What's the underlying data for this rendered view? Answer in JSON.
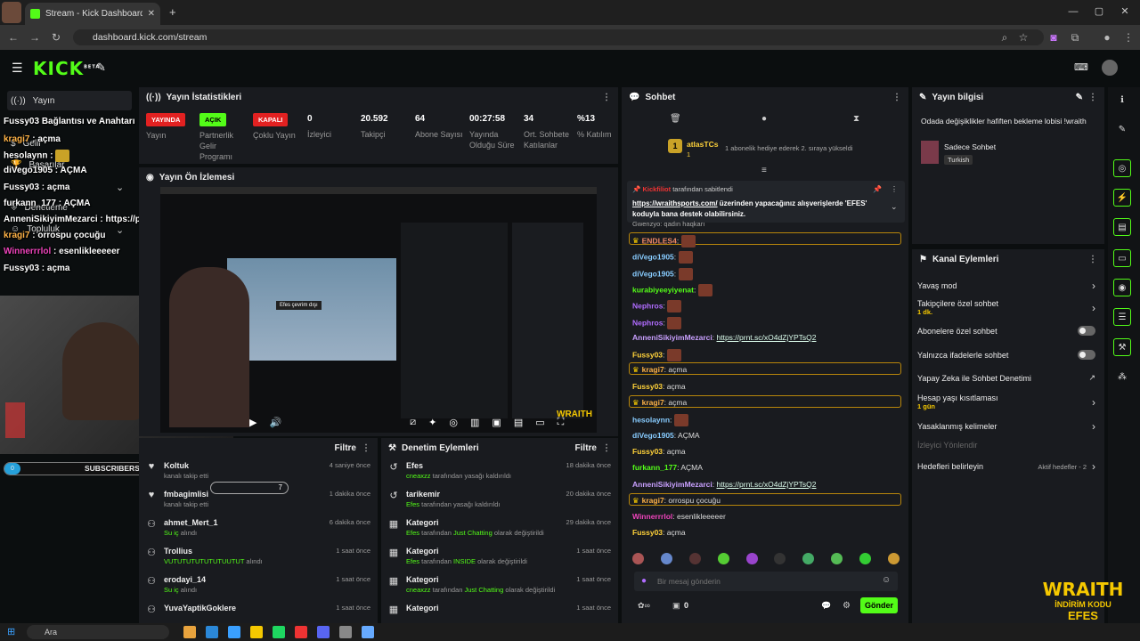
{
  "browser": {
    "tab_title": "Stream - Kick Dashboard",
    "url": "dashboard.kick.com/stream"
  },
  "header": {
    "logo": "KICK",
    "logo_sup": "BETA"
  },
  "sidebar": {
    "items": [
      {
        "label": "Yayın"
      },
      {
        "label": "Gelir"
      },
      {
        "label": "Başarılar"
      },
      {
        "label": "Denetleme"
      },
      {
        "label": "Topluluk"
      }
    ]
  },
  "overlay_chat": [
    {
      "user": "Fussy03",
      "text": "Bağlantısı ve Anahtarı"
    },
    {
      "user": "kragi7",
      "text": "açma"
    },
    {
      "user": "hesolaynn",
      "text": ""
    },
    {
      "user": "diVego1905",
      "text": "AÇMA"
    },
    {
      "user": "Fussy03",
      "text": "açma"
    },
    {
      "user": "furkann_177",
      "text": "AÇMA"
    },
    {
      "user": "AnneniSikiyimMezarci",
      "text": "https://prnt.sc/xO4dZjYPTsQ2"
    },
    {
      "user": "kragi7",
      "text": "orrospu çocuğu"
    },
    {
      "user": "Winnerrrlol",
      "text": "esenlikleeeeer"
    },
    {
      "user": "Fussy03",
      "text": "açma"
    }
  ],
  "subscribers": {
    "count": "0",
    "label": "SUBSCRIBERS"
  },
  "stats": {
    "title": "Yayın İstatistikleri",
    "items": [
      {
        "badge": "YAYINDA",
        "label": "Yayın",
        "color": "#e22121"
      },
      {
        "badge": "AÇIK",
        "label": "Partnerlik Gelir Programı",
        "color": "#53fc18"
      },
      {
        "badge": "KAPALI",
        "label": "Çoklu Yayın",
        "color": "#e22121"
      },
      {
        "value": "0",
        "label": "İzleyici"
      },
      {
        "value": "20.592",
        "label": "Takipçi"
      },
      {
        "value": "64",
        "label": "Abone Sayısı"
      },
      {
        "value": "00:27:58",
        "label": "Yayında Olduğu Süre"
      },
      {
        "value": "34",
        "label": "Ort. Sohbete Katılanlar"
      },
      {
        "value": "%13",
        "label": "% Katılım"
      }
    ]
  },
  "preview": {
    "title": "Yayın Ön İzlemesi",
    "inner_text": "Efes çevrim dışı",
    "brand": "WRAITH"
  },
  "activity": {
    "filter": "Filtre",
    "rows": [
      {
        "icon": "heart-icon",
        "name": "Koltuk",
        "sub": "kanalı takip etti",
        "time": "4 saniye önce",
        "count": "7"
      },
      {
        "icon": "heart-icon",
        "name": "fmbagimlisi",
        "sub": "kanalı takip etti",
        "time": "1 dakika önce"
      },
      {
        "icon": "gift-icon",
        "name": "ahmet_Mert_1",
        "sub": "Su iç",
        "sub2": "alındı",
        "time": "6 dakika önce"
      },
      {
        "icon": "gift-icon",
        "name": "Trollius",
        "sub": "VUTUTUTUTUTUTUUTUT",
        "sub2": "alındı",
        "time": "1 saat önce"
      },
      {
        "icon": "gift-icon",
        "name": "erodayi_14",
        "sub": "Su iç",
        "sub2": "alındı",
        "time": "1 saat önce"
      },
      {
        "icon": "gift-icon",
        "name": "YuvaYaptikGoklere",
        "sub": "",
        "time": "1 saat önce"
      }
    ]
  },
  "moderation": {
    "title": "Denetim Eylemleri",
    "filter": "Filtre",
    "rows": [
      {
        "icon": "undo-icon",
        "name": "Efes",
        "by": "cneaxzz",
        "sub": "tarafından yasağı kaldırıldı",
        "time": "18 dakika önce"
      },
      {
        "icon": "undo-icon",
        "name": "tarikemir",
        "by": "Efes",
        "sub": "tarafından yasağı kaldırıldı",
        "time": "20 dakika önce"
      },
      {
        "icon": "category-icon",
        "name": "Kategori",
        "by": "Efes",
        "sub": "tarafından",
        "cat": "Just Chatting",
        "sub2": "olarak değiştirildi",
        "time": "29 dakika önce"
      },
      {
        "icon": "category-icon",
        "name": "Kategori",
        "by": "Efes",
        "sub": "tarafından",
        "cat": "INSIDE",
        "sub2": "olarak değiştirildi",
        "time": "1 saat önce"
      },
      {
        "icon": "category-icon",
        "name": "Kategori",
        "by": "cneaxzz",
        "sub": "tarafından",
        "cat": "Just Chatting",
        "sub2": "olarak değiştirildi",
        "time": "1 saat önce"
      },
      {
        "icon": "category-icon",
        "name": "Kategori",
        "by": "",
        "sub": "",
        "time": "1 saat önce"
      }
    ]
  },
  "chat": {
    "title": "Sohbet",
    "gift_user": "atlasTCs",
    "gift_count": "1",
    "gift_text": "1 abonelik hediye ederek 2. sıraya yükseldi",
    "pinned_by": "Kickfiliot",
    "pinned_suffix": "tarafından sabitlendi",
    "pinned_link": "https://wraithsports.com/",
    "pinned_text": "üzerinden yapacağınız alışverişlerde 'EFES' koduyla bana destek olabilirsiniz.",
    "partial": "Gwenzyo: qadın haqkarı",
    "messages": [
      {
        "user": "ENDLES4",
        "color": "#e86",
        "text": "",
        "emote": true,
        "hl": true
      },
      {
        "user": "diVego1905",
        "color": "#8cf",
        "text": "",
        "emote": true
      },
      {
        "user": "diVego1905",
        "color": "#8cf",
        "text": "",
        "emote": true
      },
      {
        "user": "kurabiyeeyiyenat",
        "color": "#53fc18",
        "text": "",
        "emote": true
      },
      {
        "user": "Nephros",
        "color": "#b06cff",
        "text": "",
        "emote": true
      },
      {
        "user": "Nephros",
        "color": "#b06cff",
        "text": "",
        "emote": true
      },
      {
        "user": "AnneniSikiyimMezarci",
        "color": "#c9a0ff",
        "link": "https://prnt.sc/xO4dZjYPTsQ2"
      },
      {
        "user": "Fussy03",
        "color": "#ffd23a",
        "text": "",
        "emote": true
      },
      {
        "user": "kragi7",
        "color": "#ffb347",
        "text": "açma",
        "hl": true
      },
      {
        "user": "Fussy03",
        "color": "#ffd23a",
        "text": "açma"
      },
      {
        "user": "kragi7",
        "color": "#ffb347",
        "text": "açma",
        "hl": true
      },
      {
        "user": "hesolaynn",
        "color": "#8cf",
        "text": "",
        "emote": true
      },
      {
        "user": "diVego1905",
        "color": "#8cf",
        "text": "AÇMA"
      },
      {
        "user": "Fussy03",
        "color": "#ffd23a",
        "text": "açma"
      },
      {
        "user": "furkann_177",
        "color": "#53fc18",
        "text": "AÇMA"
      },
      {
        "user": "AnneniSikiyimMezarci",
        "color": "#c9a0ff",
        "link": "https://prnt.sc/xO4dZjYPTsQ2"
      },
      {
        "user": "kragi7",
        "color": "#ffb347",
        "text": "orrospu çocuğu",
        "hl": true
      },
      {
        "user": "Winnerrrlol",
        "color": "#e4b",
        "text": "esenlikleeeeer"
      },
      {
        "user": "Fussy03",
        "color": "#ffd23a",
        "text": "açma"
      }
    ],
    "input_placeholder": "Bir mesaj gönderin",
    "points": "0",
    "send": "Gönder"
  },
  "stream_info": {
    "title": "Yayın bilgisi",
    "text": "Odada değişiklikler hafiften bekleme lobisi !wraith",
    "category": "Sadece Sohbet",
    "language": "Turkish"
  },
  "channel_actions": {
    "title": "Kanal Eylemleri",
    "items": [
      {
        "label": "Yavaş mod",
        "type": "chevron"
      },
      {
        "label": "Takipçilere özel sohbet",
        "sub": "1 dk.",
        "type": "chevron"
      },
      {
        "label": "Abonelere özel sohbet",
        "type": "toggle"
      },
      {
        "label": "Yalnızca ifadelerle sohbet",
        "type": "toggle"
      },
      {
        "label": "Yapay Zeka ile Sohbet Denetimi",
        "type": "external"
      },
      {
        "label": "Hesap yaşı kısıtlaması",
        "sub": "1 gün",
        "type": "chevron"
      },
      {
        "label": "Yasaklanmış kelimeler",
        "type": "chevron"
      },
      {
        "label": "İzleyici Yönlendir",
        "type": "disabled"
      },
      {
        "label": "Hedefleri belirleyin",
        "extra": "Aktif hedefler - 2",
        "type": "chevron"
      }
    ]
  },
  "promo": {
    "brand": "WRAITH",
    "line": "İNDİRİM KODU",
    "code": "EFES"
  },
  "taskbar": {
    "search": "Ara",
    "colors": {
      "accent": "#53fc18",
      "live": "#e22121"
    }
  }
}
